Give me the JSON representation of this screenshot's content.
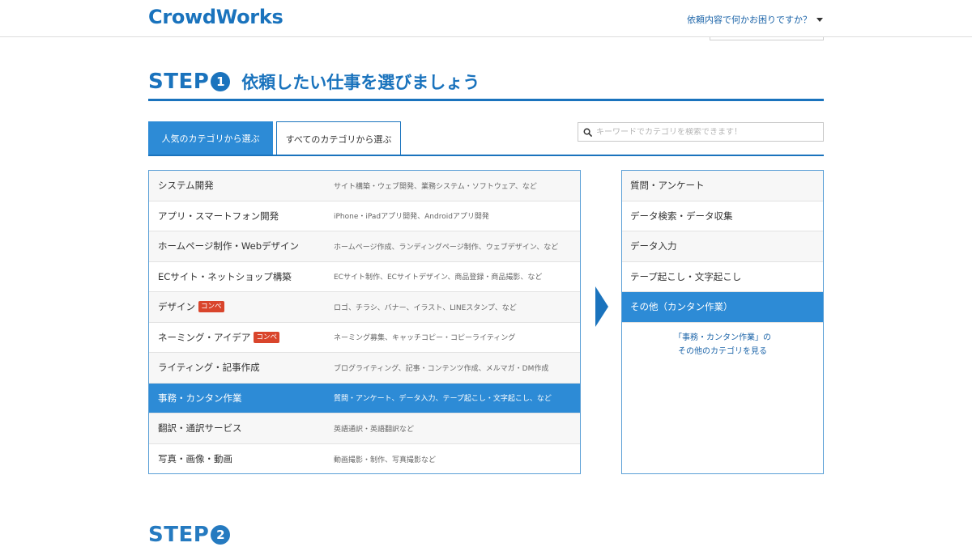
{
  "header": {
    "logo": "CrowdWorks",
    "help_label": "依頼内容で何かお困りですか？"
  },
  "step1": {
    "label": "STEP",
    "number": "1",
    "title": "依頼したい仕事を選びましょう"
  },
  "tabs": [
    {
      "label": "人気のカテゴリから選ぶ",
      "active": true
    },
    {
      "label": "すべてのカテゴリから選ぶ",
      "active": false
    }
  ],
  "search": {
    "placeholder": "キーワードでカテゴリを検索できます！"
  },
  "categories": [
    {
      "name": "システム開発",
      "desc": "サイト構築・ウェブ開発、業務システム・ソフトウェア、など",
      "badge": ""
    },
    {
      "name": "アプリ・スマートフォン開発",
      "desc": "iPhone・iPadアプリ開発、Androidアプリ開発",
      "badge": ""
    },
    {
      "name": "ホームページ制作・Webデザイン",
      "desc": "ホームページ作成、ランディングページ制作、ウェブデザイン、など",
      "badge": ""
    },
    {
      "name": "ECサイト・ネットショップ構築",
      "desc": "ECサイト制作、ECサイトデザイン、商品登録・商品撮影、など",
      "badge": ""
    },
    {
      "name": "デザイン",
      "desc": "ロゴ、チラシ、バナー、イラスト、LINEスタンプ、など",
      "badge": "コンペ"
    },
    {
      "name": "ネーミング・アイデア",
      "desc": "ネーミング募集、キャッチコピー・コピーライティング",
      "badge": "コンペ"
    },
    {
      "name": "ライティング・記事作成",
      "desc": "ブログライティング、記事・コンテンツ作成、メルマガ・DM作成",
      "badge": ""
    },
    {
      "name": "事務・カンタン作業",
      "desc": "質問・アンケート、データ入力、テープ起こし・文字起こし、など",
      "badge": "",
      "selected": true
    },
    {
      "name": "翻訳・通訳サービス",
      "desc": "英語通訳・英語翻訳など",
      "badge": ""
    },
    {
      "name": "写真・画像・動画",
      "desc": "動画撮影・制作、写真撮影など",
      "badge": ""
    }
  ],
  "subcategories": [
    {
      "name": "質問・アンケート"
    },
    {
      "name": "データ検索・データ収集"
    },
    {
      "name": "データ入力"
    },
    {
      "name": "テープ起こし・文字起こし"
    },
    {
      "name": "その他（カンタン作業）",
      "selected": true
    }
  ],
  "sub_more": {
    "line1": "「事務・カンタン作業」の",
    "line2": "その他のカテゴリを見る"
  },
  "step2": {
    "label": "STEP",
    "number": "2"
  },
  "colors": {
    "brand": "#1a73bd",
    "selected": "#2d8bd6",
    "badge": "#d9452c"
  }
}
